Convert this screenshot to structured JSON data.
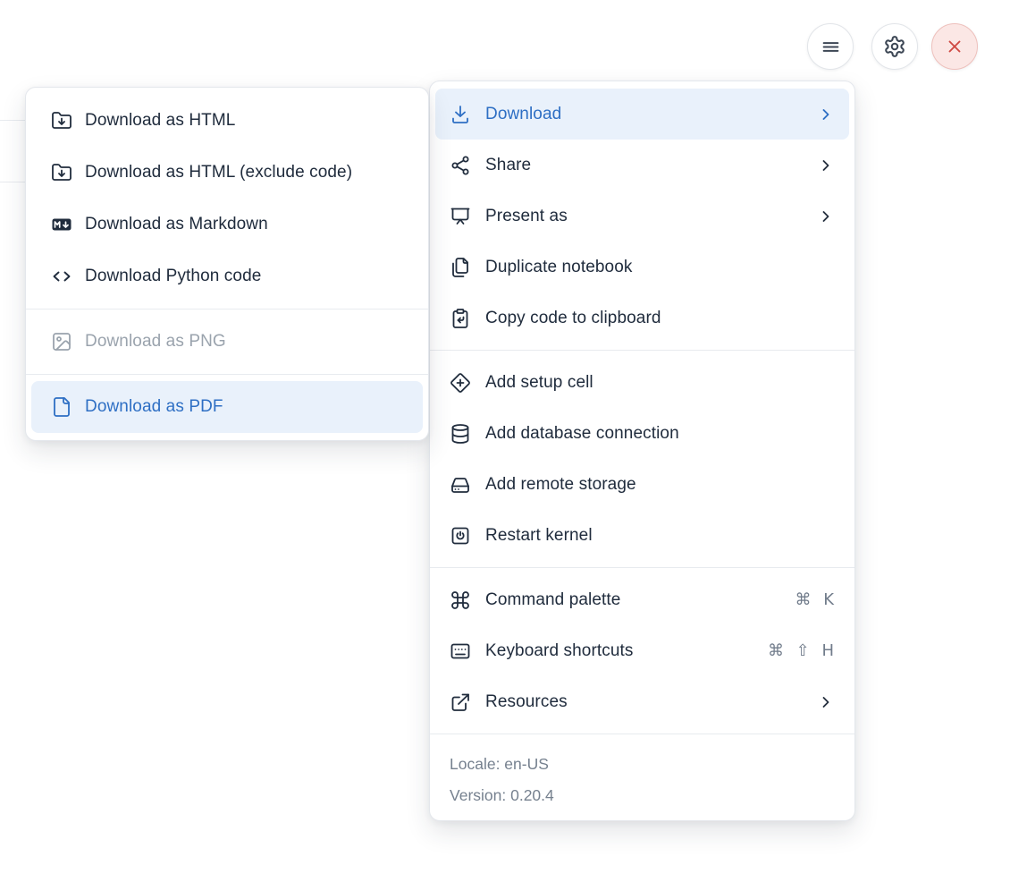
{
  "colors": {
    "accent-blue": "#2e6fc4",
    "highlight-bg": "#e9f1fb",
    "text": "#202c3d",
    "muted-text": "#76818f",
    "disabled-text": "#9aa3ad",
    "danger": "#cf4943",
    "danger-bg": "#fbe7e5",
    "danger-border": "#eec0bc",
    "border": "#e4e7ec",
    "separator": "#e8ebef"
  },
  "toolbar": {
    "buttons": [
      {
        "name": "notebook-menu",
        "icon": "hamburger-icon"
      },
      {
        "name": "settings",
        "icon": "gear-icon"
      },
      {
        "name": "close",
        "icon": "close-icon"
      }
    ]
  },
  "download_submenu": {
    "items": [
      {
        "label": "Download as HTML",
        "icon": "folder-download-icon",
        "state": "normal"
      },
      {
        "label": "Download as HTML (exclude code)",
        "icon": "folder-download-icon",
        "state": "normal"
      },
      {
        "label": "Download as Markdown",
        "icon": "markdown-icon",
        "state": "normal"
      },
      {
        "label": "Download Python code",
        "icon": "code-icon",
        "state": "normal"
      },
      {
        "label": "Download as PNG",
        "icon": "image-icon",
        "state": "disabled"
      },
      {
        "label": "Download as PDF",
        "icon": "file-icon",
        "state": "highlighted"
      }
    ]
  },
  "main_menu": {
    "items": [
      {
        "label": "Download",
        "icon": "download-icon",
        "has_submenu": true,
        "state": "highlighted"
      },
      {
        "label": "Share",
        "icon": "share-icon",
        "has_submenu": true
      },
      {
        "label": "Present as",
        "icon": "presentation-icon",
        "has_submenu": true
      },
      {
        "label": "Duplicate notebook",
        "icon": "duplicate-files-icon"
      },
      {
        "label": "Copy code to clipboard",
        "icon": "clipboard-copy-icon"
      },
      {
        "label": "Add setup cell",
        "icon": "diamond-plus-icon"
      },
      {
        "label": "Add database connection",
        "icon": "database-icon"
      },
      {
        "label": "Add remote storage",
        "icon": "hard-drive-icon"
      },
      {
        "label": "Restart kernel",
        "icon": "power-square-icon"
      },
      {
        "label": "Command palette",
        "icon": "command-icon",
        "shortcut": "⌘ K"
      },
      {
        "label": "Keyboard shortcuts",
        "icon": "keyboard-icon",
        "shortcut": "⌘ ⇧ H"
      },
      {
        "label": "Resources",
        "icon": "external-link-icon",
        "has_submenu": true
      }
    ],
    "footer": {
      "locale": "Locale: en-US",
      "version": "Version: 0.20.4"
    }
  }
}
